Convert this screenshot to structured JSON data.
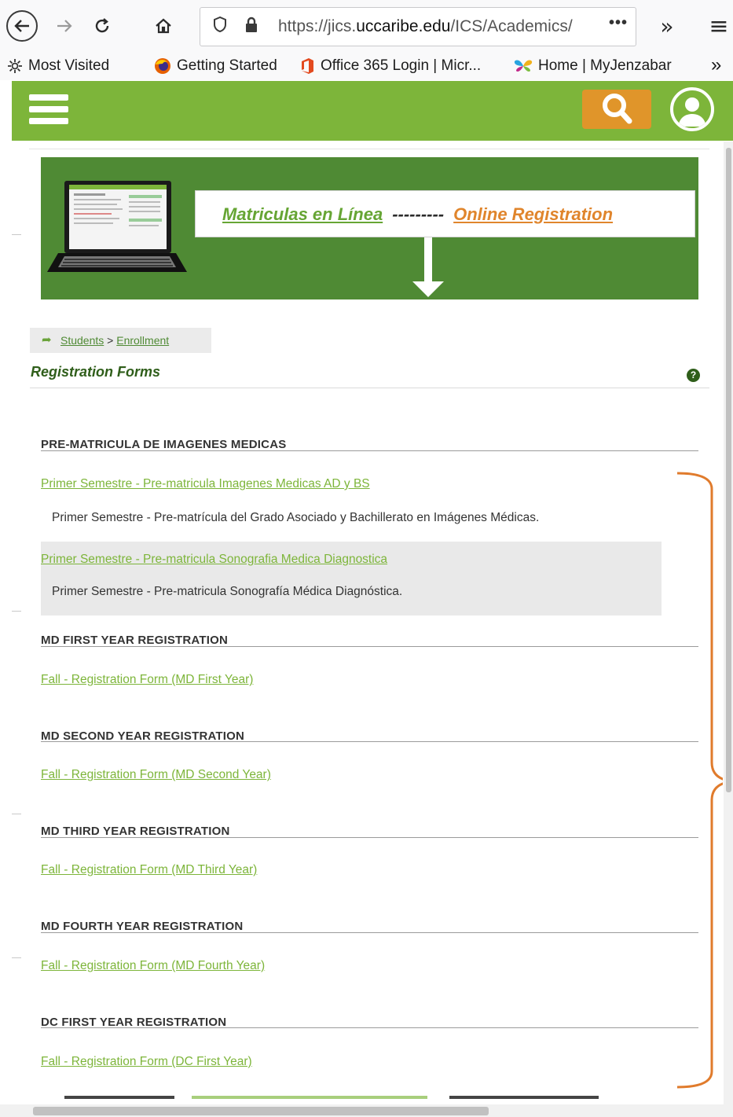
{
  "browser": {
    "url_prefix": "https://jics.",
    "url_domain": "uccaribe.edu",
    "url_path": "/ICS/Academics/",
    "url_more": "•••",
    "overflow": "»",
    "menu": "≡",
    "bookmarks": [
      {
        "label": "Most Visited",
        "icon": "gear-icon"
      },
      {
        "label": "Getting Started",
        "icon": "firefox-icon"
      },
      {
        "label": "Office 365 Login | Micr...",
        "icon": "office-icon"
      },
      {
        "label": "Home | MyJenzabar",
        "icon": "butterfly-icon"
      }
    ],
    "bookmarks_overflow": "»"
  },
  "banner": {
    "left_text": "Matriculas en Línea",
    "dashes": "---------",
    "right_text": "Online Registration"
  },
  "breadcrumb": {
    "items": [
      "Students",
      "Enrollment"
    ],
    "separator": ">"
  },
  "section": {
    "title": "Registration Forms",
    "help": "?"
  },
  "groups": [
    {
      "heading": "PRE-MATRICULA DE IMAGENES MEDICAS",
      "forms": [
        {
          "link": "Primer Semestre - Pre-matricula Imagenes Medicas AD y BS",
          "description": "Primer Semestre - Pre-matrícula del Grado Asociado y Bachillerato en Imágenes Médicas."
        },
        {
          "link": "Primer Semestre - Pre-matricula Sonografia Medica Diagnostica",
          "description": "Primer Semestre - Pre-matricula Sonografía Médica Diagnóstica."
        }
      ]
    },
    {
      "heading": "MD FIRST YEAR REGISTRATION",
      "forms": [
        {
          "link": "Fall - Registration Form (MD First Year)"
        }
      ]
    },
    {
      "heading": "MD SECOND YEAR REGISTRATION",
      "forms": [
        {
          "link": "Fall - Registration Form (MD Second Year)"
        }
      ]
    },
    {
      "heading": "MD THIRD YEAR REGISTRATION",
      "forms": [
        {
          "link": "Fall - Registration Form (MD Third Year)"
        }
      ]
    },
    {
      "heading": "MD FOURTH YEAR REGISTRATION",
      "forms": [
        {
          "link": "Fall - Registration Form (MD Fourth Year)"
        }
      ]
    },
    {
      "heading": "DC FIRST YEAR REGISTRATION",
      "forms": [
        {
          "link": "Fall - Registration Form (DC First Year)"
        }
      ]
    }
  ],
  "colors": {
    "header_green": "#7db53a",
    "banner_green": "#4f8a34",
    "search_orange": "#e0952a",
    "link_green": "#7db53a",
    "annotation_orange": "#e07b2c"
  }
}
